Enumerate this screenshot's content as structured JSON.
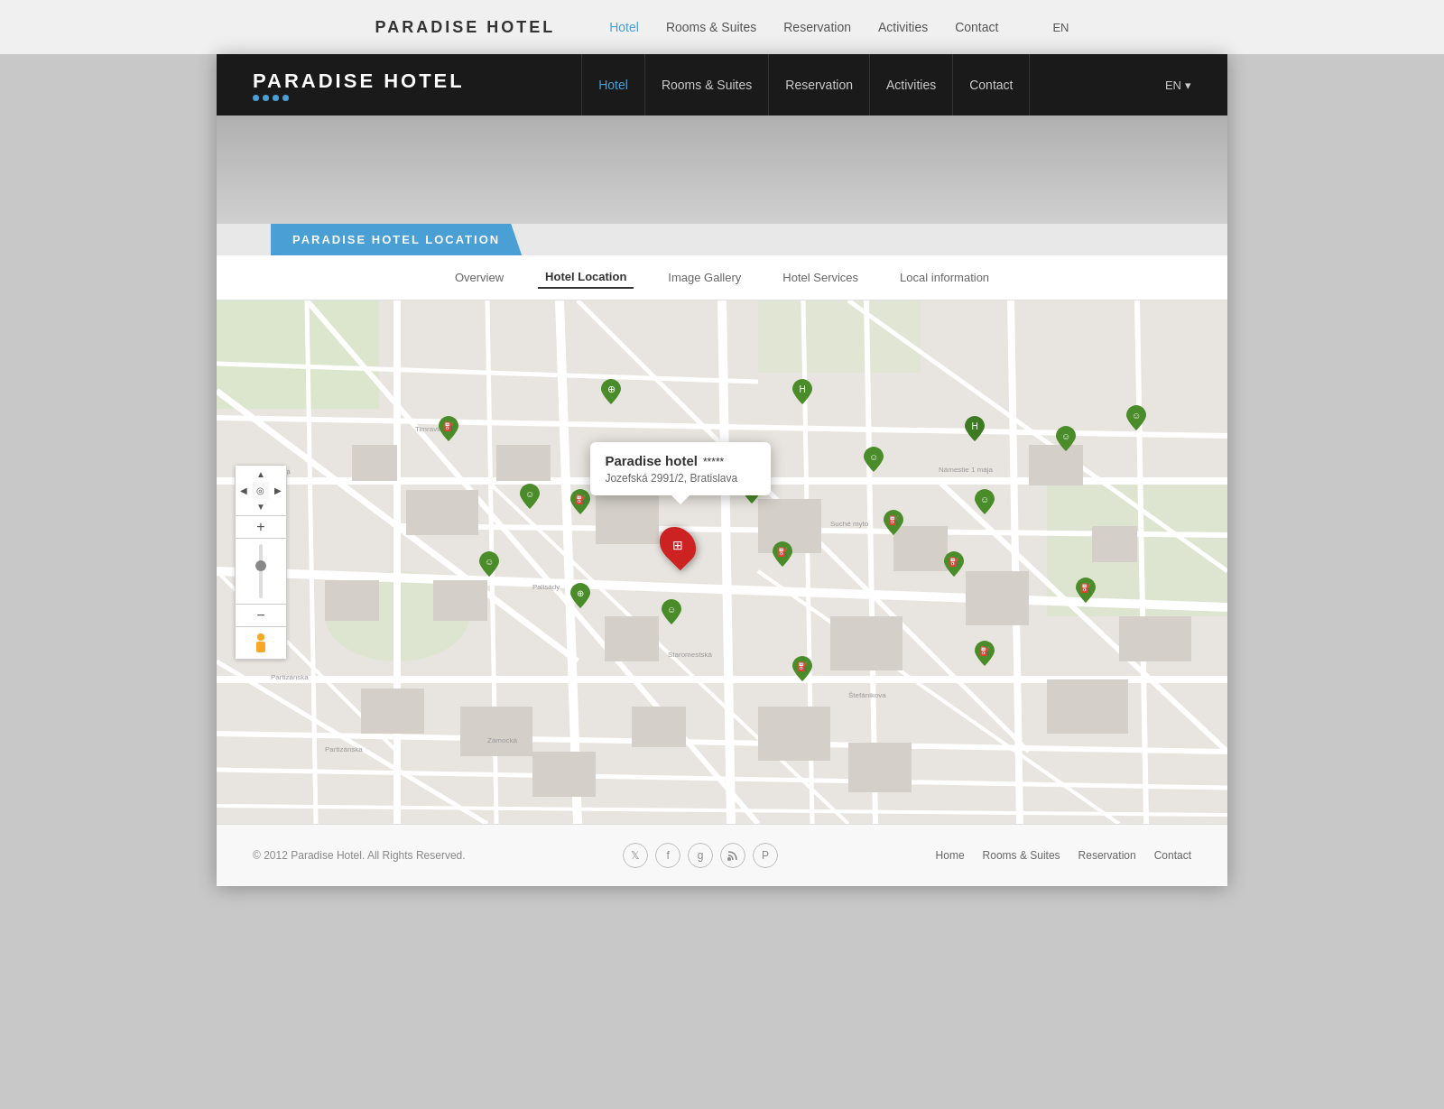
{
  "topBar": {
    "logo": "PARADISE HOTEL",
    "nav": [
      {
        "label": "Hotel",
        "active": true
      },
      {
        "label": "Rooms & Suites",
        "active": false
      },
      {
        "label": "Reservation",
        "active": false
      },
      {
        "label": "Activities",
        "active": false
      },
      {
        "label": "Contact",
        "active": false
      }
    ],
    "lang": "EN"
  },
  "header": {
    "logo": "PARADISE HOTEL",
    "stars": 4,
    "nav": [
      {
        "label": "Hotel",
        "active": true
      },
      {
        "label": "Rooms & Suites",
        "active": false
      },
      {
        "label": "Reservation",
        "active": false
      },
      {
        "label": "Activities",
        "active": false
      },
      {
        "label": "Contact",
        "active": false
      }
    ],
    "lang": "EN"
  },
  "sectionLabel": "PARADISE HOTEL LOCATION",
  "tabs": [
    {
      "label": "Overview",
      "active": false
    },
    {
      "label": "Hotel Location",
      "active": true
    },
    {
      "label": "Image Gallery",
      "active": false
    },
    {
      "label": "Hotel Services",
      "active": false
    },
    {
      "label": "Local information",
      "active": false
    }
  ],
  "popup": {
    "title": "Paradise hotel",
    "stars": "*****",
    "address": "Jozefská 2991/2, Bratislava"
  },
  "mapControls": {
    "zoomIn": "+",
    "zoomOut": "-",
    "north": "▲",
    "south": "▼",
    "east": "▶",
    "west": "◀"
  },
  "footer": {
    "copyright": "© 2012 Paradise Hotel. All Rights Reserved.",
    "links": [
      {
        "label": "Home"
      },
      {
        "label": "Rooms & Suites"
      },
      {
        "label": "Reservation"
      },
      {
        "label": "Contact"
      }
    ],
    "social": [
      "twitter",
      "facebook",
      "google-plus",
      "rss",
      "pinterest"
    ]
  }
}
